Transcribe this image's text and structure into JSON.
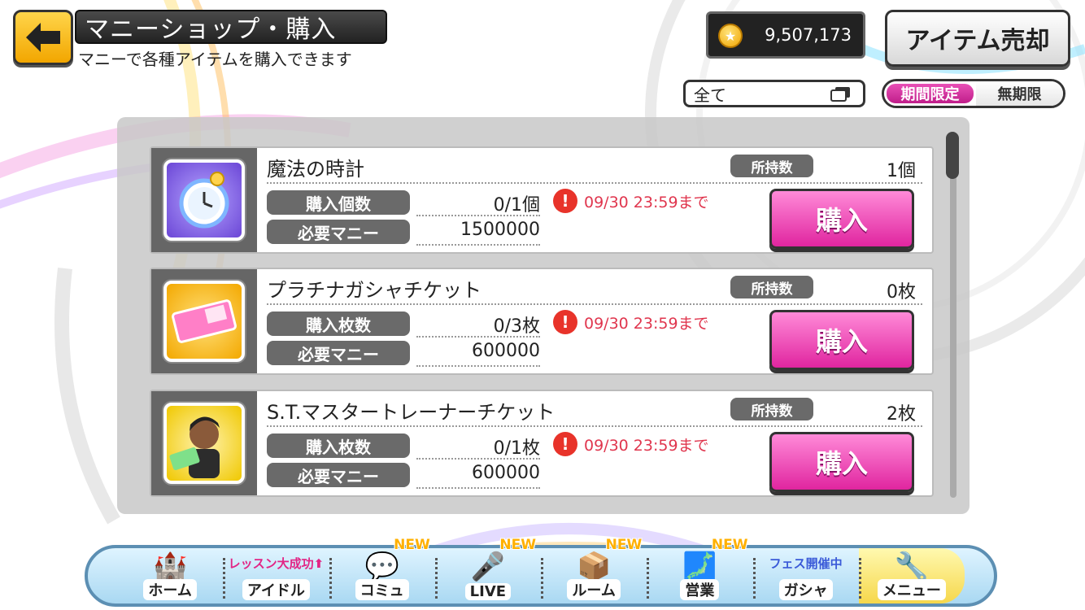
{
  "header": {
    "title": "マニーショップ・購入",
    "subtitle": "マニーで各種アイテムを購入できます",
    "money": "9,507,173",
    "sell_button": "アイテム売却"
  },
  "filters": {
    "category_selected": "全て",
    "period_options": [
      "期間限定",
      "無期限"
    ],
    "period_active": "期間限定"
  },
  "items": [
    {
      "name": "魔法の時計",
      "owned_label": "所持数",
      "owned_value": "1個",
      "purchase_label": "購入個数",
      "purchase_value": "0/1個",
      "cost_label": "必要マニー",
      "cost_value": "1500000",
      "limit": "09/30 23:59まで",
      "buy_label": "購入",
      "icon": "stopwatch-icon"
    },
    {
      "name": "プラチナガシャチケット",
      "owned_label": "所持数",
      "owned_value": "0枚",
      "purchase_label": "購入枚数",
      "purchase_value": "0/3枚",
      "cost_label": "必要マニー",
      "cost_value": "600000",
      "limit": "09/30 23:59まで",
      "buy_label": "購入",
      "icon": "gacha-ticket-icon"
    },
    {
      "name": "S.T.マスタートレーナーチケット",
      "owned_label": "所持数",
      "owned_value": "2枚",
      "purchase_label": "購入枚数",
      "purchase_value": "0/1枚",
      "cost_label": "必要マニー",
      "cost_value": "600000",
      "limit": "09/30 23:59まで",
      "buy_label": "購入",
      "icon": "trainer-portrait-icon"
    }
  ],
  "nav": {
    "home": "ホーム",
    "idol": "アイドル",
    "idol_note": "レッスン大成功⬆",
    "commu": "コミュ",
    "live": "LIVE",
    "room": "ルーム",
    "business": "営業",
    "gacha": "ガシャ",
    "gacha_note": "フェス開催中",
    "menu": "メニュー",
    "new_badge": "NEW"
  },
  "colors": {
    "accent_pink": "#e0259f",
    "warning_red": "#e8332a",
    "limit_text": "#e0364e"
  }
}
